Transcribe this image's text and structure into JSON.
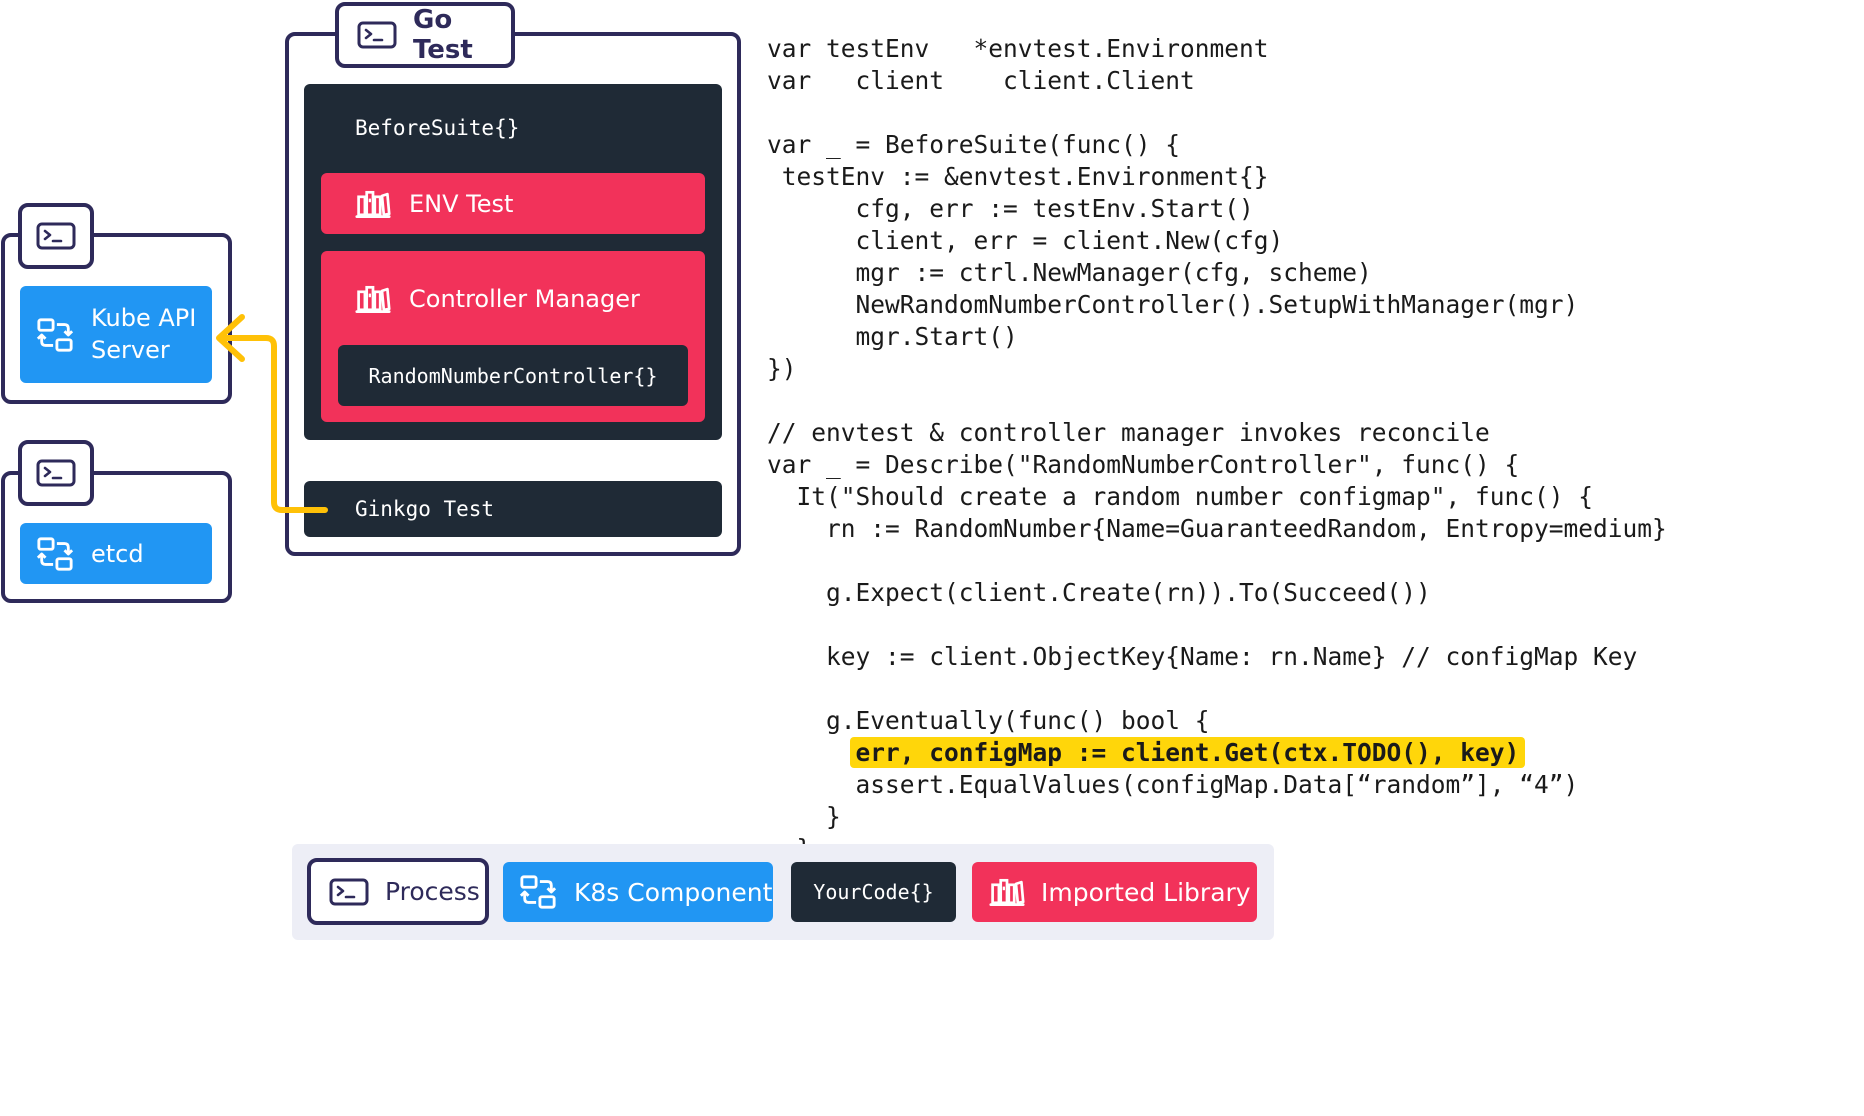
{
  "colors": {
    "process_outline": "#2e2a5a",
    "k8s_component": "#2196f3",
    "your_code": "#1f2a36",
    "imported_library": "#f2325a",
    "arrow": "#ffc107",
    "highlight": "#ffd60a"
  },
  "go_test": {
    "title": "Go Test",
    "before_suite": "BeforeSuite{}",
    "env_test": "ENV Test",
    "controller_manager": "Controller Manager",
    "random_number_controller": "RandomNumberController{}",
    "ginkgo_test": "Ginkgo Test"
  },
  "left": {
    "kube_api_line1": "Kube API",
    "kube_api_line2": "Server",
    "etcd": "etcd"
  },
  "code": {
    "lines": [
      "var testEnv   *envtest.Environment",
      "var   client    client.Client",
      "",
      "var _ = BeforeSuite(func() {",
      " testEnv := &envtest.Environment{}",
      "      cfg, err := testEnv.Start()",
      "      client, err = client.New(cfg)",
      "      mgr := ctrl.NewManager(cfg, scheme)",
      "      NewRandomNumberController().SetupWithManager(mgr)",
      "      mgr.Start()",
      "})",
      "",
      "// envtest & controller manager invokes reconcile",
      "var _ = Describe(\"RandomNumberController\", func() {",
      "  It(\"Should create a random number configmap\", func() {",
      "    rn := RandomNumber{Name=GuaranteedRandom, Entropy=medium}",
      "",
      "    g.Expect(client.Create(rn)).To(Succeed())",
      "",
      "    key := client.ObjectKey{Name: rn.Name} // configMap Key",
      "",
      "    g.Eventually(func() bool {",
      "      ",
      "      assert.EqualValues(configMap.Data[“random”], “4”)",
      "    }",
      "  }",
      "}"
    ],
    "highlighted_line": "err, configMap := client.Get(ctx.TODO(), key)"
  },
  "legend": {
    "process": "Process",
    "k8s_component": "K8s Component",
    "your_code": "YourCode{}",
    "imported_library": "Imported Library"
  },
  "icons": {
    "process": "terminal-icon",
    "k8s": "swap-arrows-icon",
    "library": "books-icon"
  }
}
